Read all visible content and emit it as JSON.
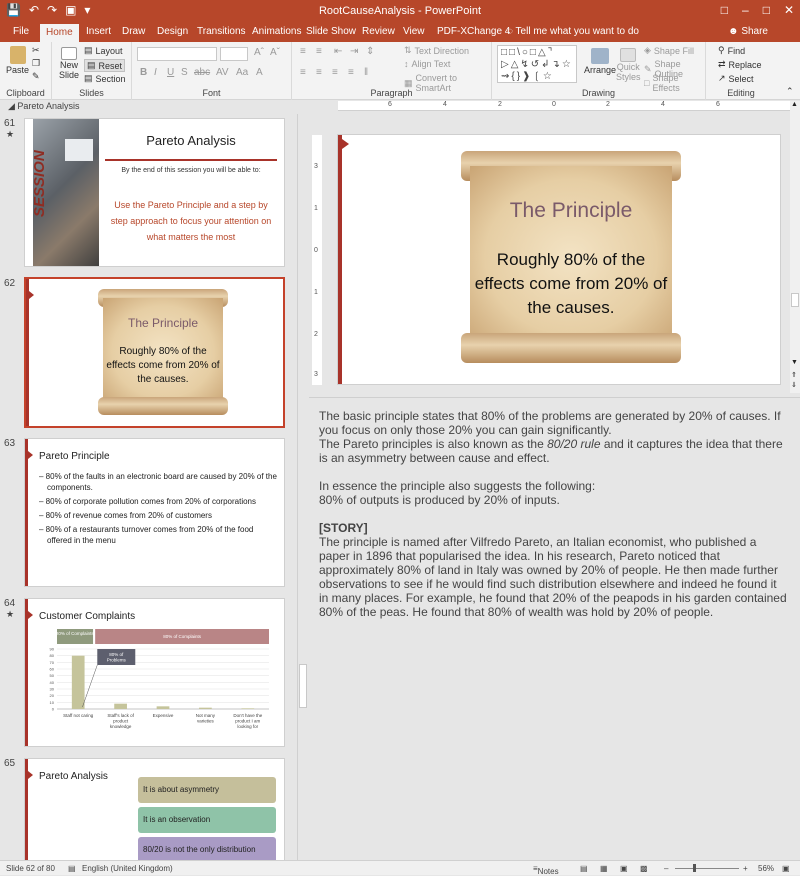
{
  "app": {
    "title": "RootCauseAnalysis  -  PowerPoint",
    "tabs": [
      "File",
      "Home",
      "Insert",
      "Draw",
      "Design",
      "Transitions",
      "Animations",
      "Slide Show",
      "Review",
      "View",
      "PDF-XChange 4"
    ],
    "active_tab": "Home",
    "tell_me": "Tell me what you want to do",
    "share": "Share"
  },
  "ribbon": {
    "clipboard": {
      "paste": "Paste",
      "label": "Clipboard"
    },
    "slides": {
      "new_slide": "New",
      "new_slide2": "Slide",
      "layout": "Layout",
      "reset": "Reset",
      "section": "Section",
      "label": "Slides"
    },
    "font": {
      "label": "Font"
    },
    "paragraph": {
      "text_direction": "Text Direction",
      "align_text": "Align Text",
      "convert_smartart": "Convert to SmartArt",
      "label": "Paragraph"
    },
    "drawing": {
      "arrange": "Arrange",
      "quick_styles": "Quick",
      "quick_styles2": "Styles",
      "shape_fill": "Shape Fill",
      "shape_outline": "Shape Outline",
      "shape_effects": "Shape Effects",
      "label": "Drawing"
    },
    "editing": {
      "find": "Find",
      "replace": "Replace",
      "select": "Select",
      "label": "Editing"
    }
  },
  "pane": {
    "section": "Pareto Analysis"
  },
  "slides": [
    {
      "num": "61",
      "star": "★",
      "side_word": "SESSION",
      "title": "Pareto Analysis",
      "subtitle": "By the end of this session you will be able to:",
      "body": "Use the Pareto Principle and a step by step approach to focus your attention on what matters the most"
    },
    {
      "num": "62",
      "title": "The Principle",
      "body": "Roughly 80% of the effects come from 20% of the causes."
    },
    {
      "num": "63",
      "title": "Pareto Principle",
      "bullets": [
        "80% of the faults in an electronic board are caused by 20% of the components.",
        "80% of corporate pollution comes from 20% of corporations",
        "80% of revenue comes from 20% of customers",
        "80% of a restaurants turnover comes from 20% of the food offered in the menu"
      ]
    },
    {
      "num": "64",
      "star": "★",
      "title": "Customer Complaints"
    },
    {
      "num": "65",
      "title": "Pareto Analysis",
      "boxes": [
        "It is about asymmetry",
        "It is an observation",
        "80/20 is not the only distribution"
      ]
    }
  ],
  "chart_data": {
    "type": "bar",
    "title": "",
    "categories": [
      "Staff not caring",
      "Staff's lack of product knowledge",
      "Expensive",
      "Not many varieties",
      "Don't have the product I am looking for"
    ],
    "values": [
      80,
      8,
      4,
      2,
      1
    ],
    "ylim": [
      0,
      90
    ],
    "yticks": [
      "90",
      "80",
      "70",
      "60",
      "50",
      "40",
      "30",
      "20",
      "10",
      "0"
    ],
    "header_left": "20% of Complaints",
    "header_right": "80% of Complaints",
    "callout": "80% of Problems",
    "colors": {
      "bar": "#c5c49b",
      "header_left": "#8f9a7d",
      "header_right": "#b98586",
      "callout": "#5d5f6e"
    }
  },
  "main_slide": {
    "title": "The Principle",
    "body": "Roughly 80% of the effects come from 20% of the causes."
  },
  "notes": {
    "p1": "The basic principle states that 80% of the problems are generated by 20% of causes. If you focus on only those 20% you can gain significantly.",
    "p2a": "The Pareto principles is also known as the ",
    "p2b": "80/20 rule",
    "p2c": " and it captures the idea that there is an asymmetry between cause and effect.",
    "p3": "In essence the principle also suggests the following:",
    "p4": "80% of outputs is produced by 20% of inputs.",
    "story": "[STORY]",
    "p5": "The principle is named after Vilfredo Pareto, an Italian economist, who published a paper in 1896 that popularised the idea. In his research, Pareto noticed that approximately 80% of land in Italy was owned by 20% of people. He then made further observations to see if he would find such distribution elsewhere and indeed he found it in many places. For example, he found that 20% of the peapods in his garden contained 80% of the peas. He found that 80% of wealth was hold by 20% of people."
  },
  "status": {
    "slide": "Slide 62 of 80",
    "language": "English (United Kingdom)",
    "notes": "Notes",
    "zoom": "56%"
  },
  "colors": {
    "accent": "#b7472a",
    "ribbon": "#f3f3f3",
    "selected_border": "#c4422b"
  }
}
